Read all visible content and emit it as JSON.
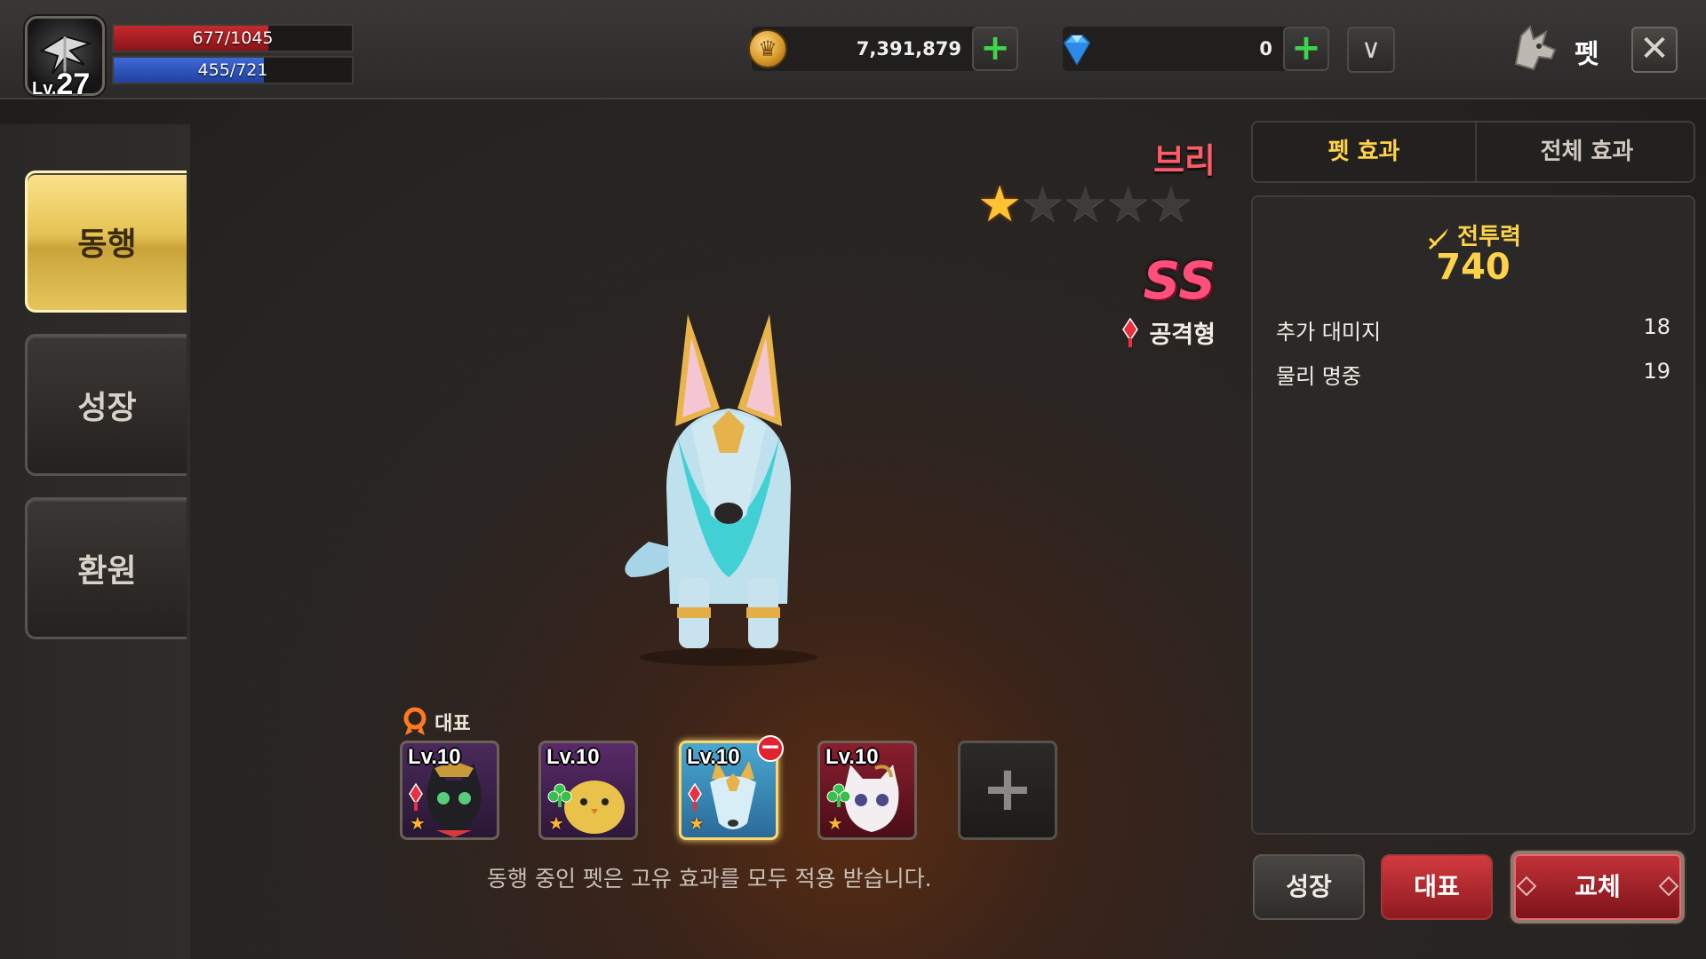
{
  "player": {
    "level_prefix": "Lv.",
    "level": "27",
    "hp": "677/1045",
    "hp_fraction": 0.648,
    "mp": "455/721",
    "mp_fraction": 0.631
  },
  "currency": {
    "gold": "7,391,879",
    "gems": "0",
    "gold_icon": "crown-coin-icon",
    "gem_icon": "diamond-icon",
    "add_symbol": "+",
    "dropdown_symbol": "∨"
  },
  "header": {
    "title": "펫",
    "close_symbol": "✕"
  },
  "nav": {
    "tabs": [
      {
        "label": "동행",
        "active": true
      },
      {
        "label": "성장",
        "active": false
      },
      {
        "label": "환원",
        "active": false
      }
    ]
  },
  "pet": {
    "name": "브리",
    "stars_total": 5,
    "stars_filled": 1,
    "grade": "SS",
    "type": "공격형"
  },
  "slots": {
    "leader_label": "대표",
    "items": [
      {
        "level": "Lv.10",
        "type": "attack",
        "pet": "black-cat"
      },
      {
        "level": "Lv.10",
        "type": "support",
        "pet": "yellow-chick"
      },
      {
        "level": "Lv.10",
        "type": "attack",
        "pet": "blue-fox",
        "selected": true
      },
      {
        "level": "Lv.10",
        "type": "support",
        "pet": "white-cat"
      }
    ],
    "add_symbol": "+",
    "remove_symbol": "−"
  },
  "notice": "동행 중인 펫은 고유 효과를 모두 적용 받습니다.",
  "effects": {
    "tabs": [
      "펫 효과",
      "전체 효과"
    ],
    "combat_power_label": "전투력",
    "combat_power": "740",
    "stats": [
      {
        "name": "추가 대미지",
        "value": "18"
      },
      {
        "name": "물리 명중",
        "value": "19"
      }
    ]
  },
  "actions": {
    "grow": "성장",
    "leader": "대표",
    "swap": "교체"
  },
  "colors": {
    "accent_gold": "#ffd24a",
    "pet_name": "#ff5a6a",
    "hp": "#c42a2f",
    "mp": "#3e69d6",
    "plus": "#3fd44a"
  }
}
